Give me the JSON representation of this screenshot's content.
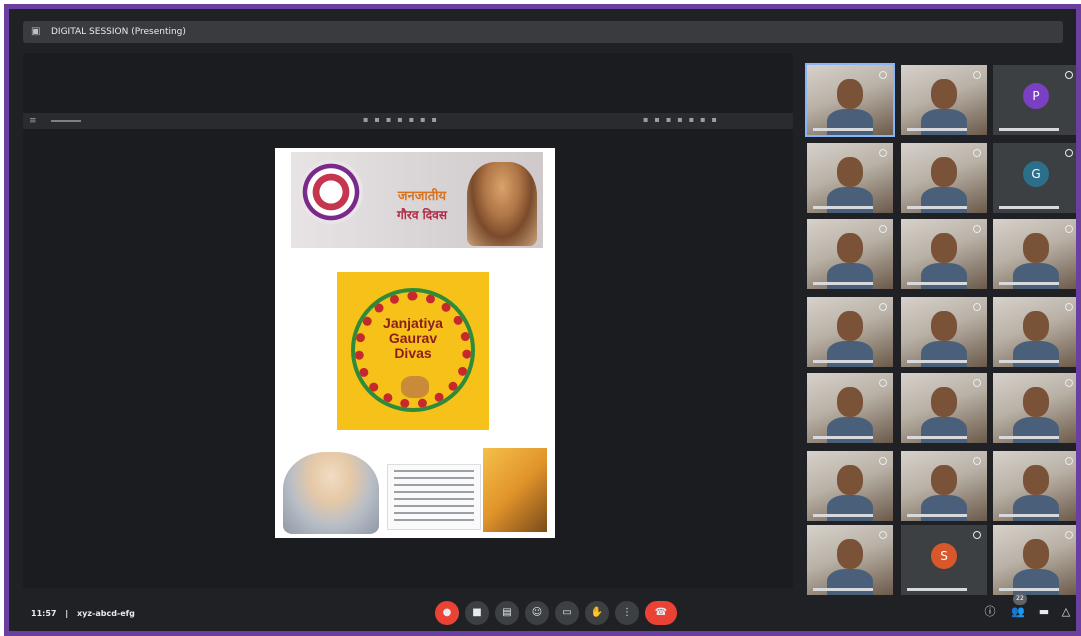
{
  "window": {
    "title": "DIGITAL SESSION (Presenting)"
  },
  "viewer": {
    "menu_icon": "menu-icon"
  },
  "document": {
    "banner": {
      "line1": "जनजातीय",
      "line2": "गौरव दिवस"
    },
    "poster": {
      "line1": "Janjatiya",
      "line2": "Gaurav",
      "line3": "Divas"
    }
  },
  "participants": [
    {
      "type": "video",
      "active": true
    },
    {
      "type": "video"
    },
    {
      "type": "avatar",
      "initial": "P",
      "color": "#7b3fc4"
    },
    {
      "type": "video"
    },
    {
      "type": "video"
    },
    {
      "type": "avatar",
      "initial": "G",
      "color": "#2b6f8a"
    },
    {
      "type": "video"
    },
    {
      "type": "video"
    },
    {
      "type": "video"
    },
    {
      "type": "video"
    },
    {
      "type": "video"
    },
    {
      "type": "video"
    },
    {
      "type": "video"
    },
    {
      "type": "video"
    },
    {
      "type": "video"
    },
    {
      "type": "video"
    },
    {
      "type": "video"
    },
    {
      "type": "video"
    },
    {
      "type": "video"
    },
    {
      "type": "avatar",
      "initial": "S",
      "color": "#d9582b"
    },
    {
      "type": "video"
    }
  ],
  "footer": {
    "time": "11:57",
    "separator": "|",
    "meeting_code": "xyz-abcd-efg"
  },
  "controls": {
    "mic_icon": "mic-off-icon",
    "camera_icon": "camera-icon",
    "captions_icon": "captions-icon",
    "emoji_icon": "emoji-icon",
    "present_icon": "present-icon",
    "raise_icon": "hand-icon",
    "more_icon": "more-icon",
    "end_icon": "end-call-icon"
  },
  "right_panel": {
    "people_count": "22"
  }
}
